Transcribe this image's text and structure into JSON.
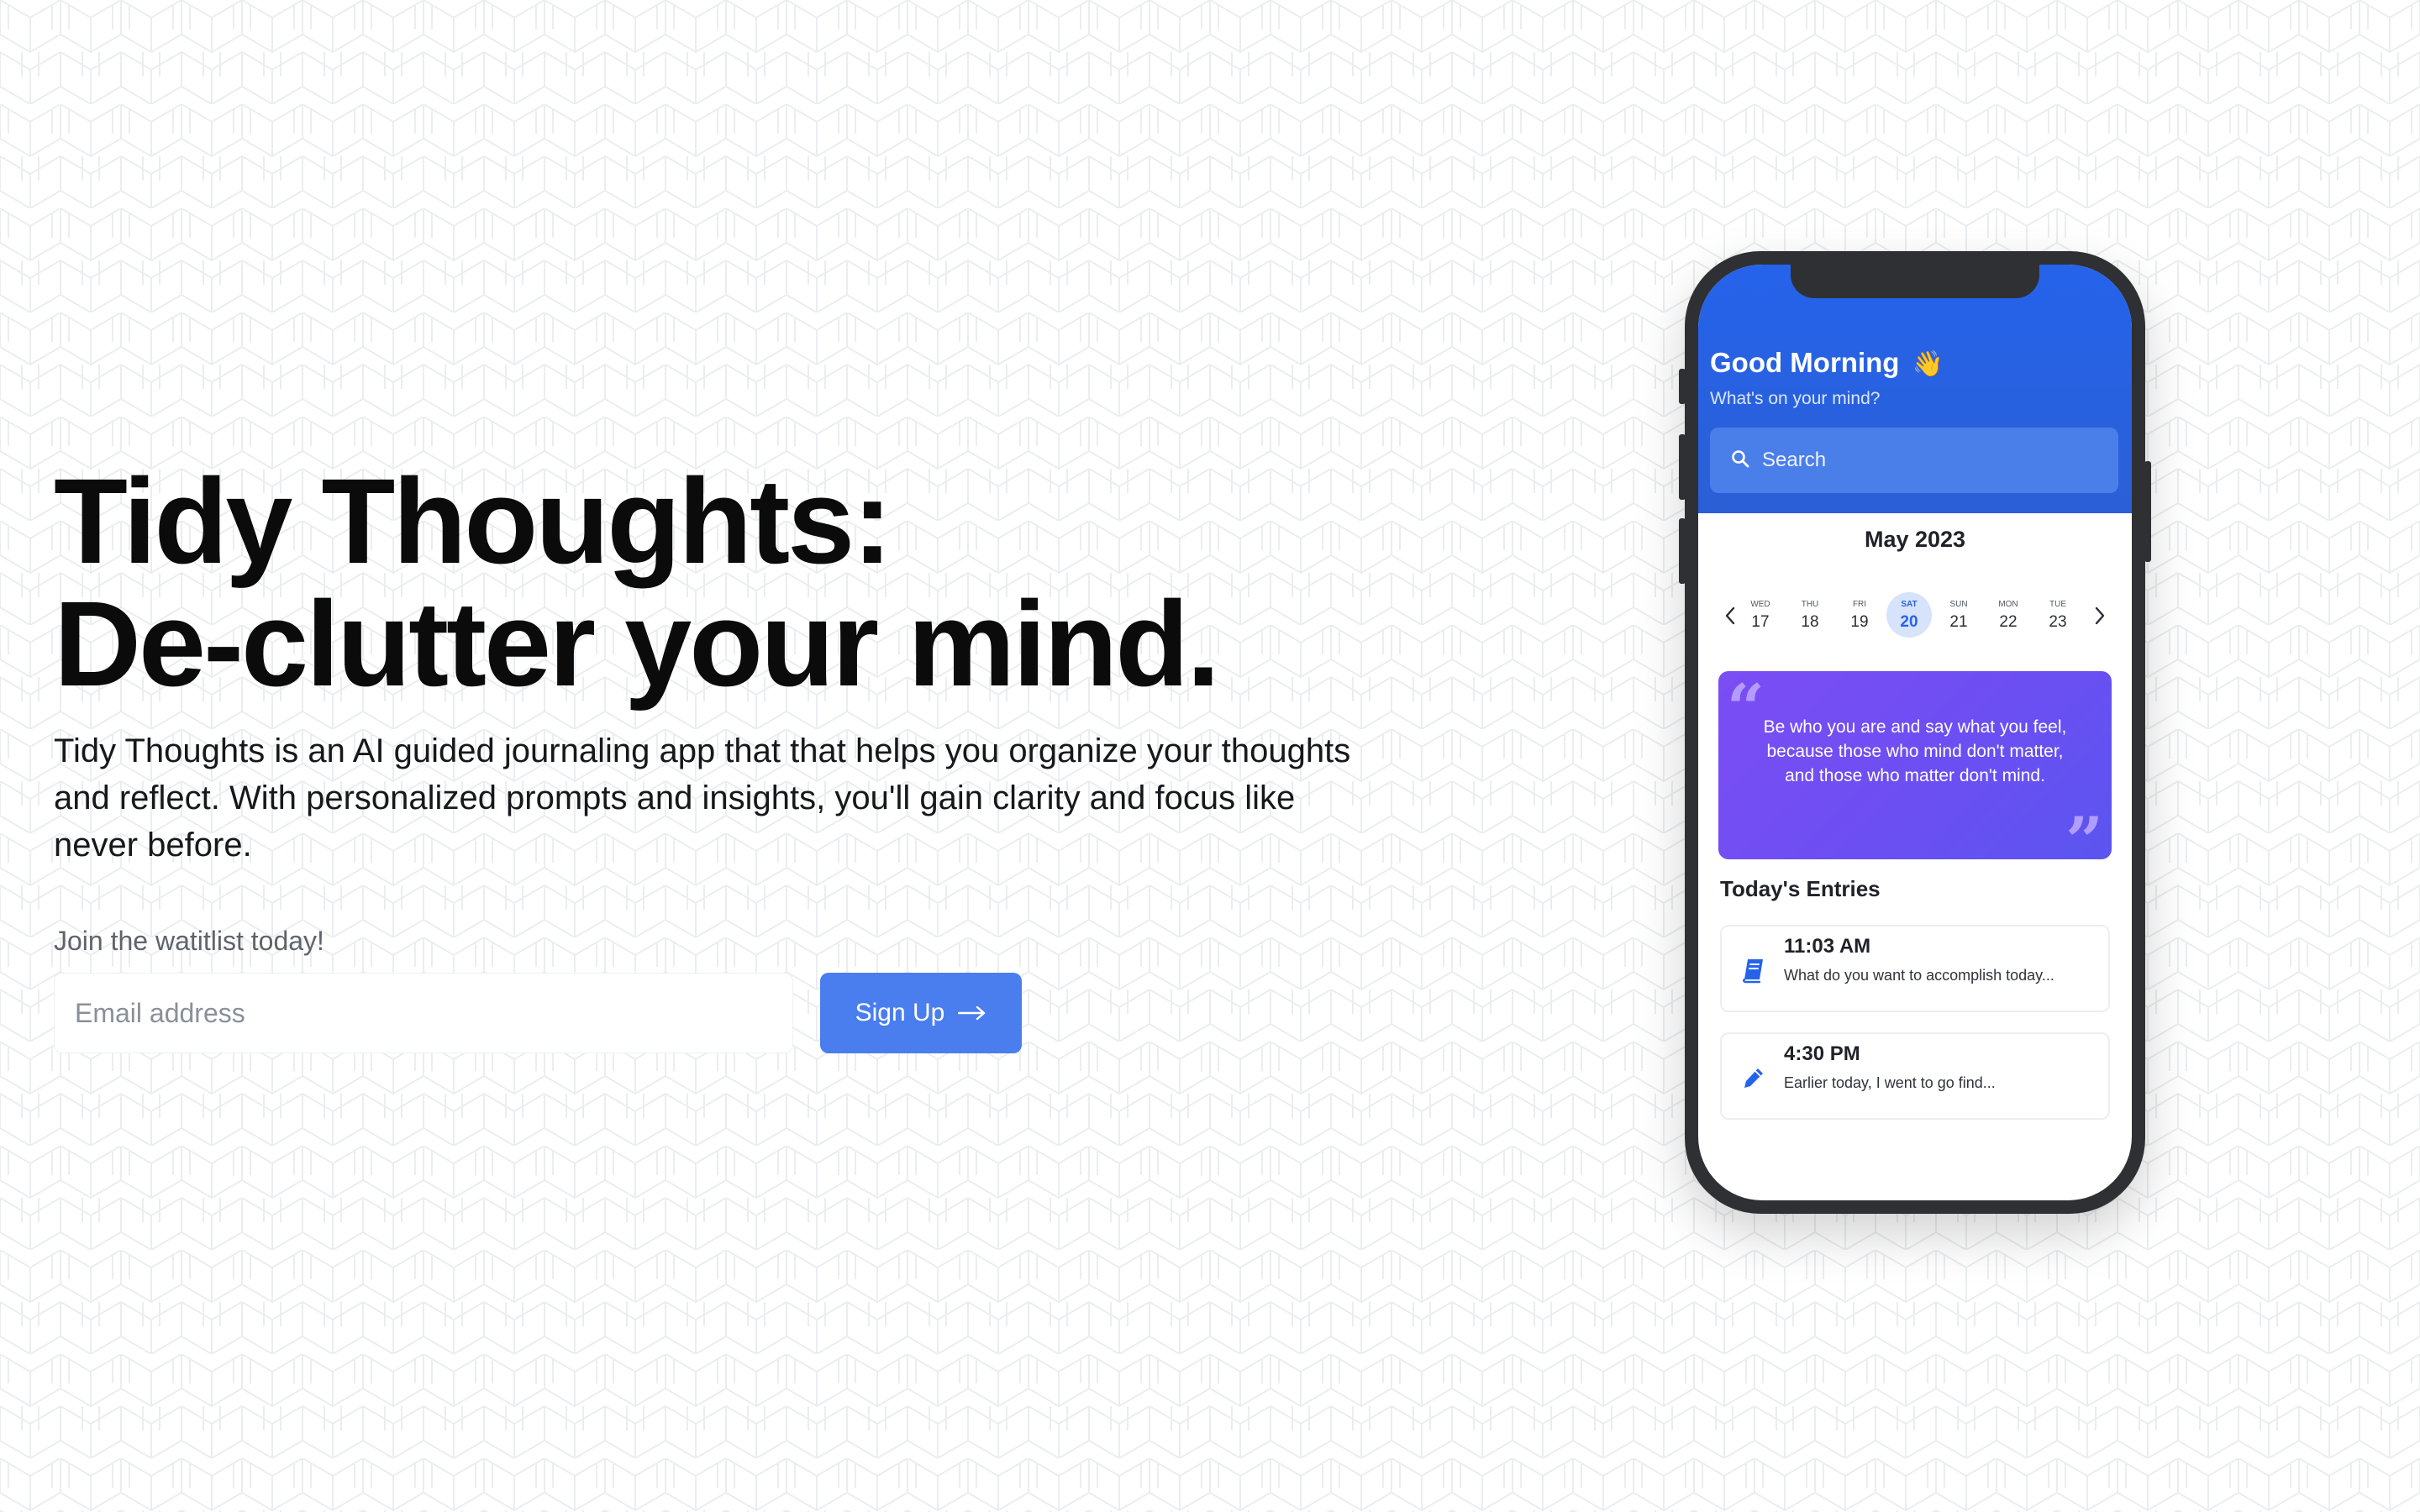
{
  "hero": {
    "headline_line1": "Tidy Thoughts:",
    "headline_line2": "De-clutter your mind.",
    "description": "Tidy Thoughts is an AI guided journaling app that that helps you organize your thoughts and reflect. With personalized prompts and insights, you'll gain clarity and focus like never before.",
    "waitlist_label": "Join the watitlist today!",
    "email_placeholder": "Email address",
    "signup_label": "Sign Up",
    "signup_icon": "arrow-right-icon"
  },
  "phone": {
    "greeting": "Good Morning",
    "greeting_emoji": "👋",
    "subgreeting": "What's on your mind?",
    "search_placeholder": "Search",
    "month": "May 2023",
    "days": [
      {
        "dow": "WED",
        "num": "17",
        "selected": false
      },
      {
        "dow": "THU",
        "num": "18",
        "selected": false
      },
      {
        "dow": "FRI",
        "num": "19",
        "selected": false
      },
      {
        "dow": "SAT",
        "num": "20",
        "selected": true
      },
      {
        "dow": "SUN",
        "num": "21",
        "selected": false
      },
      {
        "dow": "MON",
        "num": "22",
        "selected": false
      },
      {
        "dow": "TUE",
        "num": "23",
        "selected": false
      }
    ],
    "quote": "Be who you are and say what you feel, because those who mind don't matter, and those who matter don't mind.",
    "entries_title": "Today's Entries",
    "entries": [
      {
        "time": "11:03 AM",
        "text": "What do you want to accomplish today...",
        "icon": "book-icon"
      },
      {
        "time": "4:30 PM",
        "text": "Earlier today, I went to go find...",
        "icon": "pencil-icon"
      }
    ]
  },
  "colors": {
    "accent": "#4a7eef",
    "phone_header": "#2563eb",
    "quote_card": "#7c4df4",
    "headline": "#0b0b0c"
  }
}
